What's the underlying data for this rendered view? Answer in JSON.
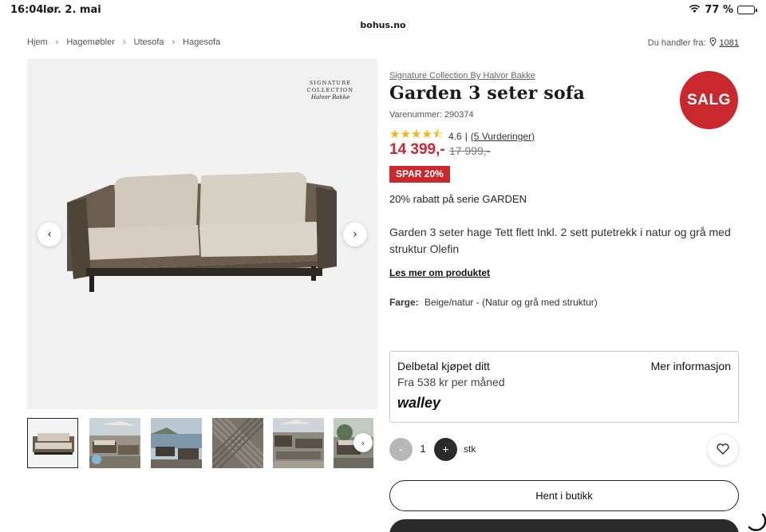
{
  "status_bar": {
    "time": "16:04",
    "date": "lør. 2. mai",
    "battery": "77 %",
    "battery_level": 0.77,
    "url": "bohus.no"
  },
  "breadcrumb": [
    "Hjem",
    "Hagemøbler",
    "Utesofa",
    "Hagesofa"
  ],
  "location": {
    "label": "Du handler fra:",
    "store": "1081"
  },
  "gallery": {
    "logo_line1": "SIGNATURE",
    "logo_line2": "COLLECTION",
    "logo_line3": "Halvor Bakke"
  },
  "product": {
    "brand": "Signature Collection By Halvor Bakke",
    "title": "Garden 3 seter sofa",
    "sku": "Varenummer: 290374",
    "rating": "4.6",
    "rating_value": 4.6,
    "rating_sep": "|",
    "reviews": "(5 Vurderinger)",
    "price_now": "14 399,-",
    "price_was": "17 999,-",
    "sale_badge": "SALG",
    "save_tag": "SPAR 20%",
    "campaign": "20% rabatt på serie GARDEN",
    "description": "Garden 3 seter hage Tett flett Inkl. 2 sett putetrekk i natur og grå med struktur Olefin",
    "read_more": "Les mer om produktet",
    "color_label": "Farge:",
    "color_value": "Beige/natur - (Natur og grå med struktur)"
  },
  "finance": {
    "title": "Delbetal kjøpet ditt",
    "more": "Mer informasjon",
    "monthly": "Fra 538 kr per måned",
    "provider": "walley"
  },
  "quantity": {
    "minus": "-",
    "value": "1",
    "plus": "+",
    "unit": "stk"
  },
  "buttons": {
    "pickup": "Hent i butikk"
  },
  "colors": {
    "accent_red": "#c8282e",
    "star": "#f2b51b",
    "dark": "#2b2b2b"
  }
}
